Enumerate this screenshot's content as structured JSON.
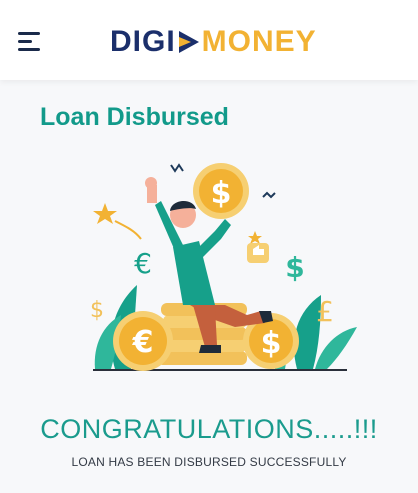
{
  "header": {
    "logo_part1": "DIGI",
    "logo_part2": "MONEY",
    "menu_icon": "hamburger-menu-icon",
    "colors": {
      "logo_dark": "#1b2f6b",
      "logo_accent": "#f2b233"
    }
  },
  "main": {
    "title": "Loan Disbursed",
    "congrats": "CONGRATULATIONS.....!!!",
    "message": "LOAN HAS BEEN DISBURSED SUCCESSFULLY",
    "illustration": {
      "icons": [
        "dollar-coin-icon",
        "euro-coin-icon",
        "euro-symbol-icon",
        "dollar-symbol-icon",
        "pound-symbol-icon",
        "star-icon",
        "thumbs-up-icon"
      ],
      "coin_symbols": {
        "dollar": "$",
        "euro": "€",
        "pound": "£"
      }
    },
    "colors": {
      "teal": "#129a8a",
      "coin": "#f2c15a",
      "coin_dark": "#e9a23b"
    }
  }
}
